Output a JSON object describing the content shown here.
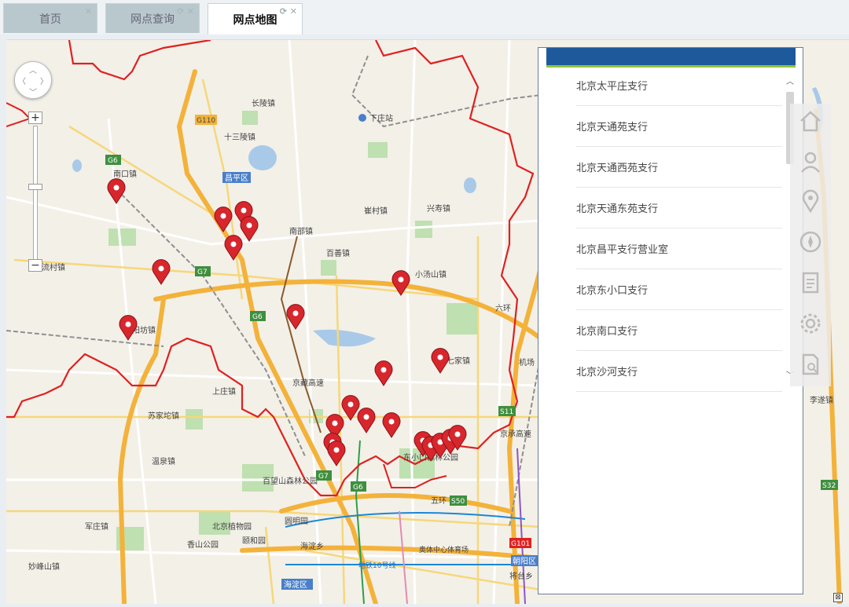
{
  "tabs": [
    {
      "label": "首页",
      "active": false
    },
    {
      "label": "网点查询",
      "active": false
    },
    {
      "label": "网点地图",
      "active": true
    }
  ],
  "map": {
    "labels": {
      "changling": "长陵镇",
      "xiazhuang": "下庄站",
      "shisanling": "十三陵镇",
      "changping": "昌平区",
      "nankou": "南口镇",
      "cuicun": "崔村镇",
      "xingshou": "兴寿镇",
      "nanshao": "南邵镇",
      "baishan": "百善镇",
      "liucun": "流村镇",
      "xiaotangshan": "小汤山镇",
      "yangfang": "阳坊镇",
      "beiqijia": "北七家镇",
      "shangzhuang": "上庄镇",
      "sujiatuo": "苏家坨镇",
      "wenquan": "温泉镇",
      "baiwangshan": "百望山森林公园",
      "dongxiaokou": "东小口森林公园",
      "zhiwuyuan": "北京植物园",
      "yuanmingyuan": "圆明园",
      "yiheyuan": "颐和园",
      "xiangshan": "香山公园",
      "haidianxiang": "海淀乡",
      "haidianqu": "海淀区",
      "aotizhongxin": "奥体中心体育场",
      "chaoyangqu": "朝阳区",
      "lisui": "李遂镇",
      "jiangtai": "将台乡",
      "miaofengshan": "妙峰山镇",
      "junzhuang": "军庄镇",
      "subway": "地铁10号线",
      "wuhuan": "五环",
      "liuhuan": "六环",
      "jingzang": "京藏高速",
      "jingcheng": "京承高速",
      "jichang": "机场",
      "g110": "G110",
      "g6": "G6",
      "g7": "G7",
      "s11": "S11",
      "s50": "S50",
      "s32": "S32",
      "g101": "G101"
    }
  },
  "zoom": {
    "plus": "+",
    "minus": "−"
  },
  "branches": [
    "北京太平庄支行",
    "北京天通苑支行",
    "北京天通西苑支行",
    "北京天通东苑支行",
    "北京昌平支行营业室",
    "北京东小口支行",
    "北京南口支行",
    "北京沙河支行"
  ],
  "icons": [
    "home-icon",
    "user-icon",
    "location-icon",
    "compass-icon",
    "document-icon",
    "settings-icon",
    "search-document-icon"
  ],
  "colors": {
    "accent": "#1e5a9b",
    "marker": "#d8262d",
    "border": "#e02020"
  }
}
